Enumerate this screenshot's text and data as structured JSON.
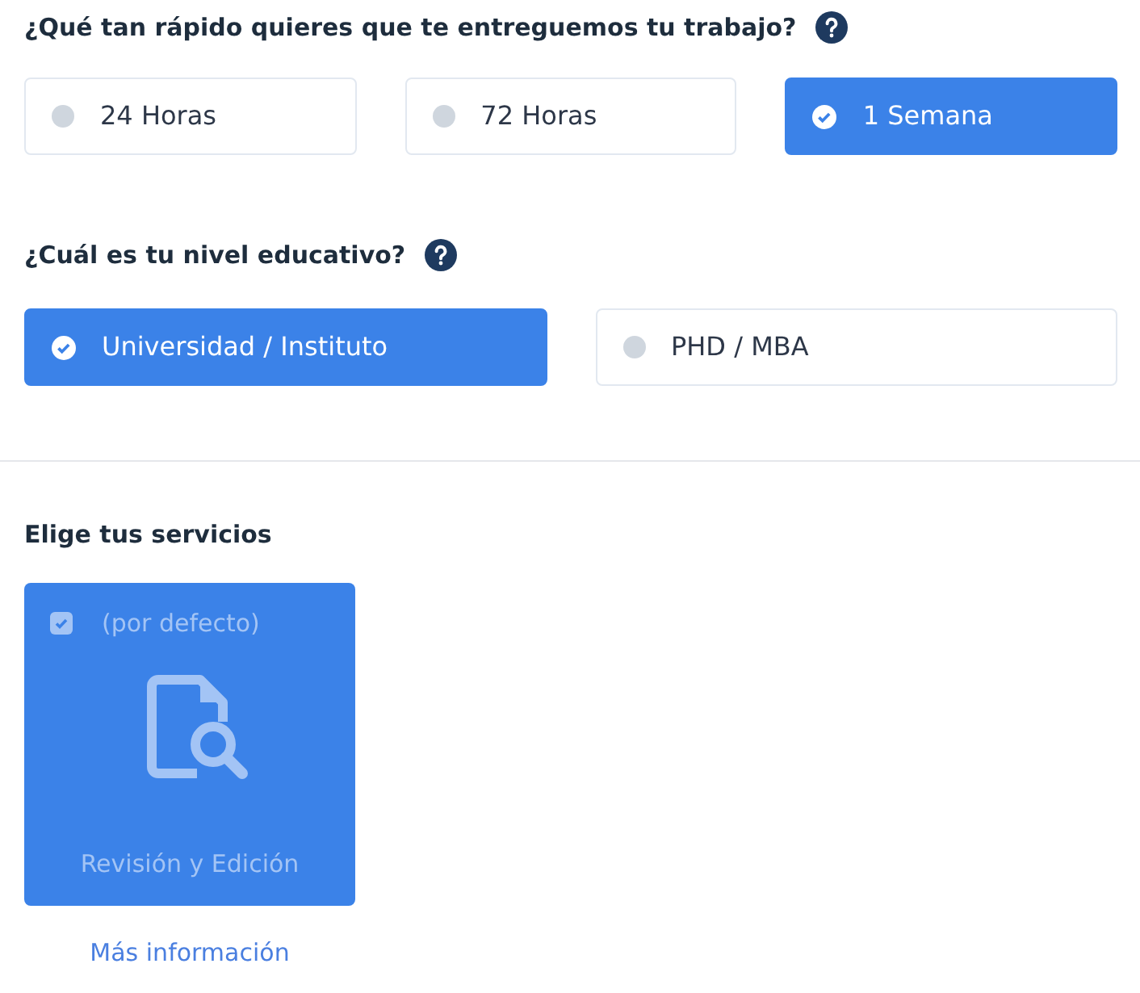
{
  "delivery": {
    "question": "¿Qué tan rápido quieres que te entreguemos tu trabajo?",
    "options": [
      {
        "label": "24 Horas",
        "selected": false
      },
      {
        "label": "72 Horas",
        "selected": false
      },
      {
        "label": "1 Semana",
        "selected": true
      }
    ]
  },
  "education": {
    "question": "¿Cuál es tu nivel educativo?",
    "options": [
      {
        "label": "Universidad / Instituto",
        "selected": true
      },
      {
        "label": "PHD / MBA",
        "selected": false
      }
    ]
  },
  "services": {
    "title": "Elige tus servicios",
    "items": [
      {
        "tag": "(por defecto)",
        "name": "Revisión y Edición",
        "checked": true,
        "link": "Más información"
      }
    ]
  }
}
